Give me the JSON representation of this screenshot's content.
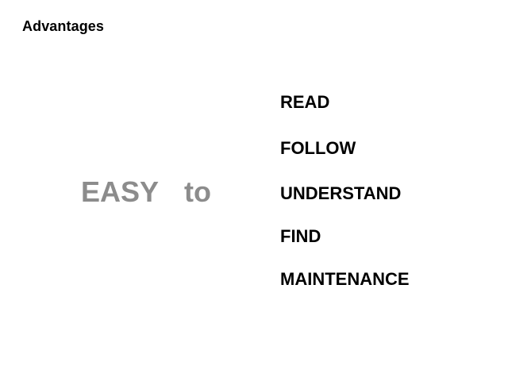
{
  "slide": {
    "title": "Advantages",
    "lead_word": "EASY",
    "connector_word": "to",
    "items": [
      "READ",
      "FOLLOW",
      "UNDERSTAND",
      "FIND",
      "MAINTENANCE"
    ]
  },
  "colors": {
    "background": "#ffffff",
    "text": "#000000",
    "accent_gray": "#8c8c8c"
  }
}
